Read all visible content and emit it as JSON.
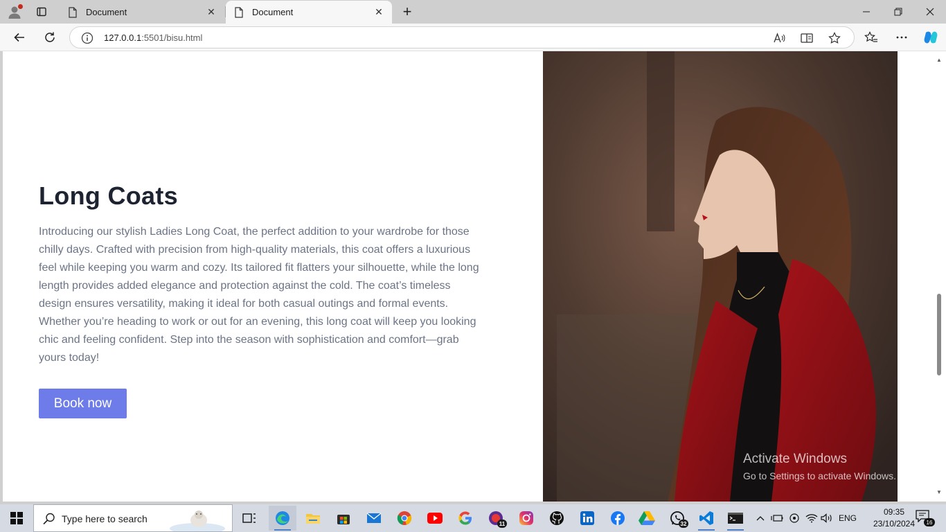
{
  "browser": {
    "tabs": [
      {
        "title": "Document",
        "active": false
      },
      {
        "title": "Document",
        "active": true
      }
    ],
    "url_host": "127.0.0.1",
    "url_rest": ":5501/bisu.html"
  },
  "page": {
    "heading": "Long Coats",
    "description": "Introducing our stylish Ladies Long Coat, the perfect addition to your wardrobe for those chilly days. Crafted with precision from high-quality materials, this coat offers a luxurious feel while keeping you warm and cozy. Its tailored fit flatters your silhouette, while the long length provides added elegance and protection against the cold. The coat’s timeless design ensures versatility, making it ideal for both casual outings and formal events. Whether you’re heading to work or out for an evening, this long coat will keep you looking chic and feeling confident. Step into the season with sophistication and comfort—grab yours today!",
    "button_label": "Book now",
    "image_subject": "woman-in-red-cardigan-photo"
  },
  "watermark": {
    "title": "Activate Windows",
    "subtitle": "Go to Settings to activate Windows."
  },
  "taskbar": {
    "search_placeholder": "Type here to search",
    "apps": [
      "task-view",
      "edge",
      "file-explorer",
      "microsoft-store",
      "mail",
      "chrome",
      "youtube",
      "google",
      "calendar-app",
      "instagram",
      "github",
      "linkedin",
      "facebook",
      "google-drive",
      "whatsapp",
      "vscode",
      "terminal"
    ],
    "badges": {
      "calendar": "11",
      "whatsapp": "32",
      "notifications": "16"
    },
    "language": "ENG",
    "time": "09:35",
    "date": "23/10/2024"
  },
  "colors": {
    "accent_button": "#6d7ce8",
    "heading": "#1d2330",
    "body_text": "#6b7385"
  }
}
